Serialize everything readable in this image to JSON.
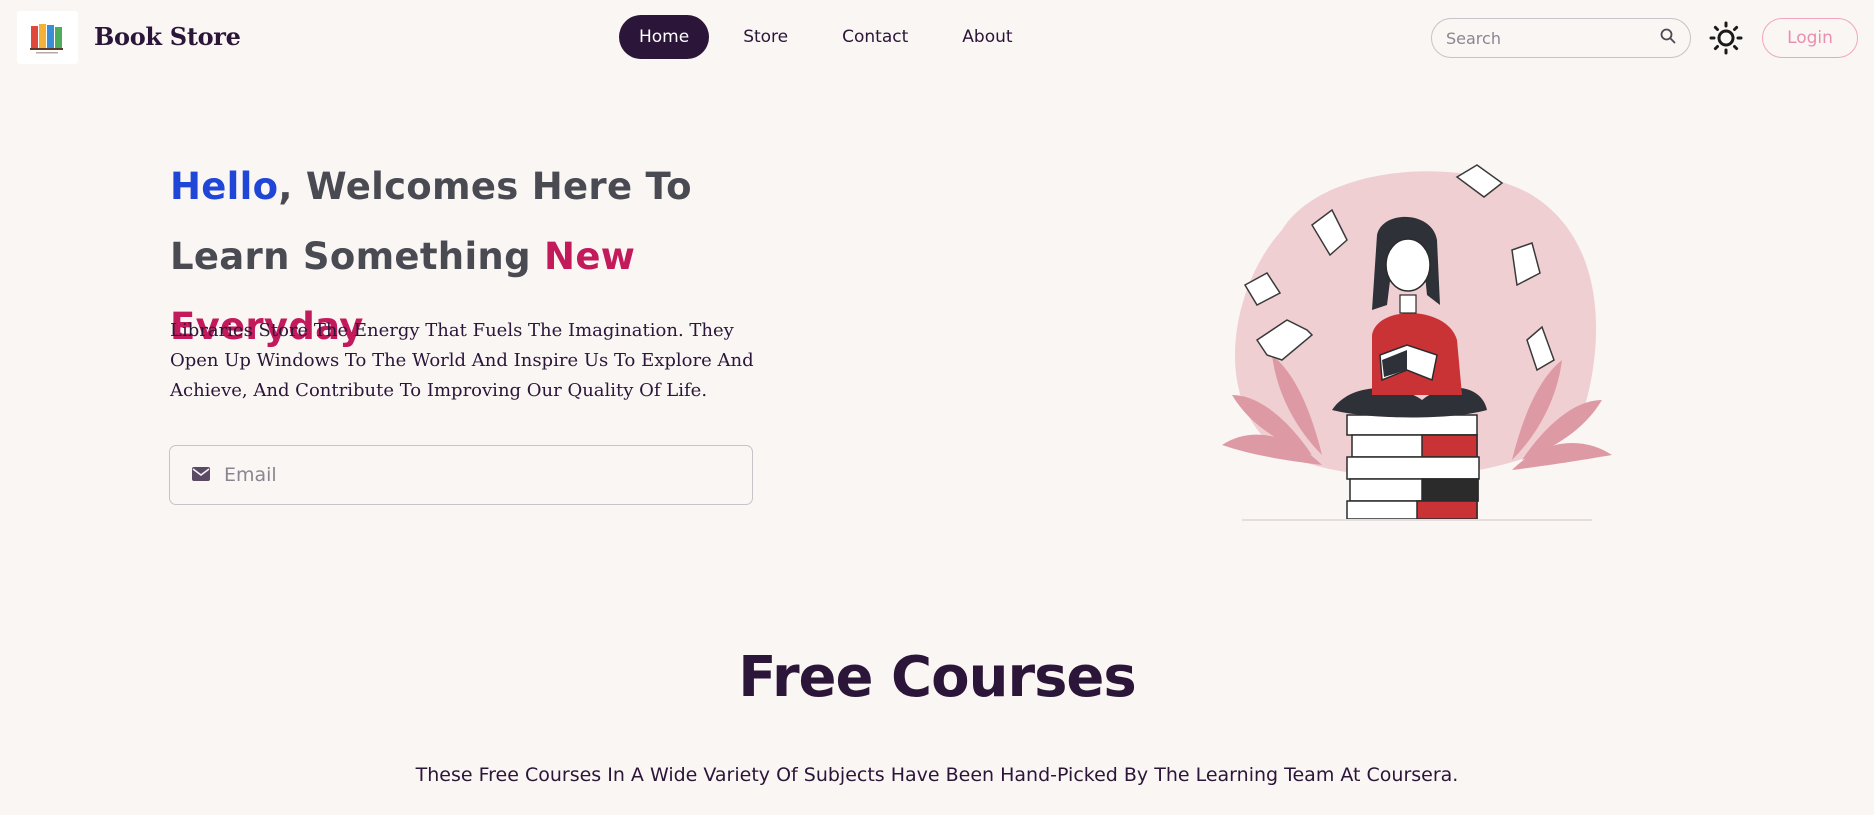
{
  "header": {
    "brand": "Book Store",
    "logo_icon": "book-logo-icon",
    "menu": [
      {
        "label": "Home",
        "active": true
      },
      {
        "label": "Store",
        "active": false
      },
      {
        "label": "Contact",
        "active": false
      },
      {
        "label": "About",
        "active": false
      }
    ],
    "search": {
      "placeholder": "Search",
      "icon": "search-icon"
    },
    "theme_icon": "sun-icon",
    "login_label": "Login"
  },
  "hero": {
    "title_hello": "Hello",
    "title_mid": ", Welcomes Here To Learn Something ",
    "title_highlight": "New Everyday",
    "paragraph": "Libraries Store The Energy That Fuels The Imagination. They Open Up Windows To The World And Inspire Us To Explore And Achieve, And Contribute To Improving Our Quality Of Life.",
    "email": {
      "placeholder": "Email",
      "icon": "mail-icon"
    }
  },
  "courses": {
    "title": "Free Courses",
    "subtitle": "These Free Courses In A Wide Variety Of Subjects Have Been Hand-Picked By The Learning Team At Coursera."
  },
  "colors": {
    "primary": "#2b1538",
    "background": "#faf6f4",
    "accent_blue": "#2046d8",
    "accent_pink": "#c31a5c",
    "login_pink": "#e88fb0"
  }
}
